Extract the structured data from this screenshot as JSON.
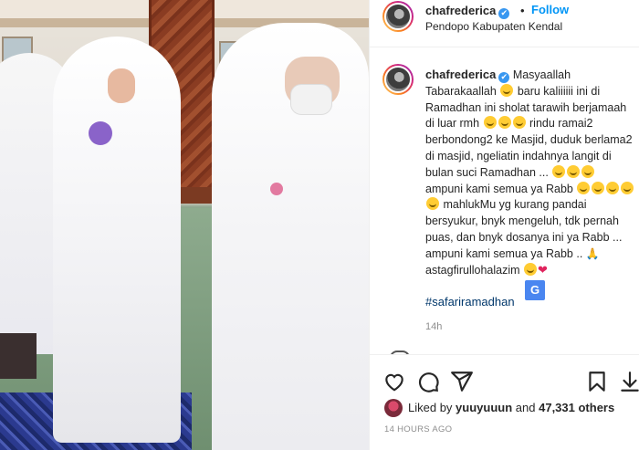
{
  "header": {
    "username": "chafrederica",
    "verified_mark": "✔",
    "separator": "•",
    "follow_label": "Follow",
    "location": "Pendopo Kabupaten Kendal"
  },
  "caption": {
    "username": "chafrederica",
    "verified_mark": "✔",
    "seg1": "Masyaallah Tabarakaallah",
    "seg2": "baru kaliiiiii ini di Ramadhan ini sholat tarawih berjamaah di luar rmh",
    "seg3": "rindu ramai2 berbondong2 ke Masjid, duduk berlama2 di masjid, ngeliatin indahnya langit di bulan suci Ramadhan ...",
    "seg4": "ampuni kami semua ya Rabb",
    "seg5": "mahlukMu yg kurang pandai bersyukur, bnyk mengeluh, tdk pernah puas, dan bnyk dosanya ini ya Rabb ... ampuni kami semua ya Rabb ..",
    "seg6": "astagfirullohalazim",
    "heart": "❤",
    "pray": "🙏",
    "hashtag": "#safariramadhan",
    "translate_label": "G",
    "time": "14h"
  },
  "actions": {
    "liked_by_prefix": "Liked by",
    "liked_by_user": "yuuyuuun",
    "and_text": "and",
    "others": "47,331 others",
    "posted_ago": "14 HOURS AGO"
  },
  "icons": [
    "heart-icon",
    "comment-icon",
    "share-icon",
    "bookmark-icon",
    "download-icon"
  ],
  "colors": {
    "follow_blue": "#0095f6",
    "verified_blue": "#3897f0",
    "hashtag_blue": "#00376b",
    "muted": "#8e8e8e"
  }
}
